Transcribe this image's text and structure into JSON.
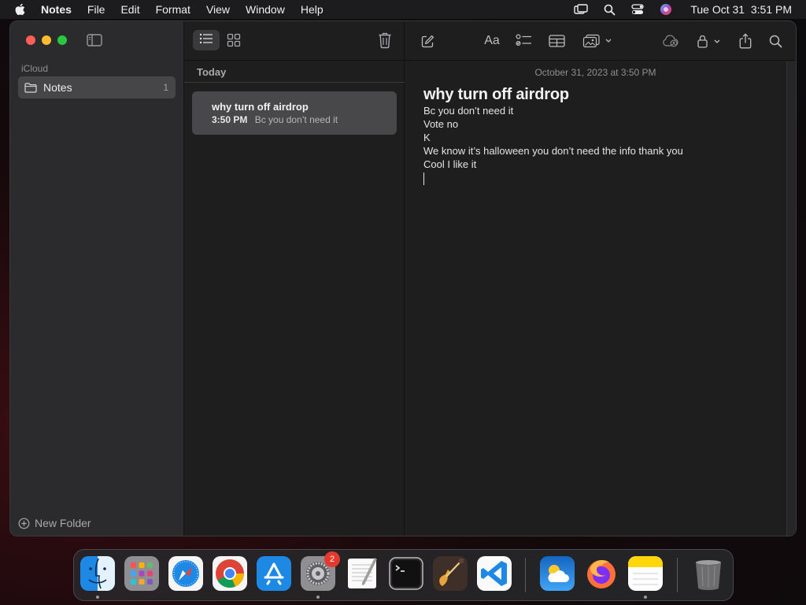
{
  "menubar": {
    "app_name": "Notes",
    "items": [
      "File",
      "Edit",
      "Format",
      "View",
      "Window",
      "Help"
    ],
    "clock": "Tue Oct 31  3:51 PM"
  },
  "sidebar": {
    "account_label": "iCloud",
    "folder": {
      "name": "Notes",
      "count": "1"
    },
    "new_folder_label": "New Folder"
  },
  "note_list": {
    "section": "Today",
    "notes": [
      {
        "title": "why turn off airdrop",
        "time": "3:50 PM",
        "preview": "Bc you don’t need it"
      }
    ]
  },
  "editor": {
    "date": "October 31, 2023 at 3:50 PM",
    "title": "why turn off airdrop",
    "lines": [
      "Bc you don’t need it",
      "Vote no",
      "K",
      "We know it’s halloween you don’t need the info thank you",
      "Cool I like it"
    ],
    "format_label": "Aa"
  },
  "dock": {
    "apps": [
      "finder-icon",
      "launchpad-icon",
      "safari-icon",
      "chrome-icon",
      "app-store-icon",
      "system-settings-icon",
      "textedit-icon",
      "terminal-icon",
      "garageband-icon",
      "vscode-icon",
      "weather-icon",
      "firefox-icon",
      "notes-icon",
      "trash-icon"
    ],
    "settings_badge": "2"
  },
  "colors": {
    "accent_red": "#ff5f57",
    "accent_yellow": "#febc2e",
    "accent_green": "#28c840",
    "selection": "#48484a"
  }
}
